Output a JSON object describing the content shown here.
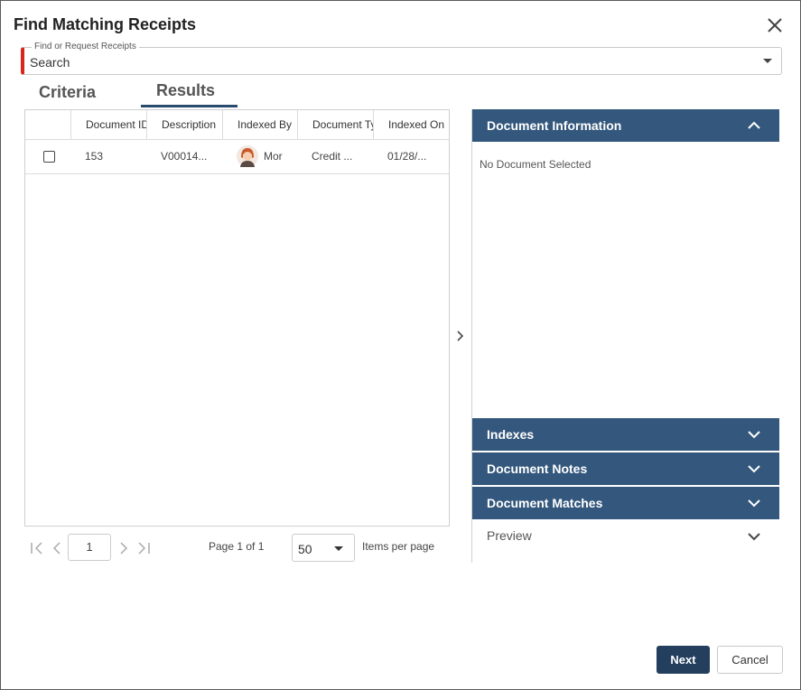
{
  "dialog": {
    "title": "Find Matching Receipts",
    "close_icon": "close-icon"
  },
  "search": {
    "legend": "Find or Request Receipts",
    "value": "Search"
  },
  "tabs": [
    {
      "label": "Criteria",
      "active": false
    },
    {
      "label": "Results",
      "active": true
    }
  ],
  "grid": {
    "columns": [
      "Document ID",
      "Description",
      "Indexed By",
      "Document Type",
      "Indexed On"
    ],
    "rows": [
      {
        "document_id": "153",
        "description": "V00014...",
        "indexed_by": "Mor",
        "document_type": "Credit ...",
        "indexed_on": "01/28/..."
      }
    ]
  },
  "pager": {
    "page_input": "1",
    "page_info": "Page 1 of 1",
    "page_size": "50",
    "items_per_page_label": "Items per page"
  },
  "side_panel": {
    "document_information": {
      "title": "Document Information",
      "empty_text": "No Document Selected"
    },
    "indexes": {
      "title": "Indexes"
    },
    "document_notes": {
      "title": "Document Notes"
    },
    "document_matches": {
      "title": "Document Matches"
    },
    "preview": {
      "title": "Preview"
    }
  },
  "footer": {
    "next_label": "Next",
    "cancel_label": "Cancel"
  },
  "colors": {
    "panel_header": "#34587d",
    "primary_button": "#243f5e",
    "required_marker": "#d9261c",
    "tab_underline": "#2a4a70"
  }
}
